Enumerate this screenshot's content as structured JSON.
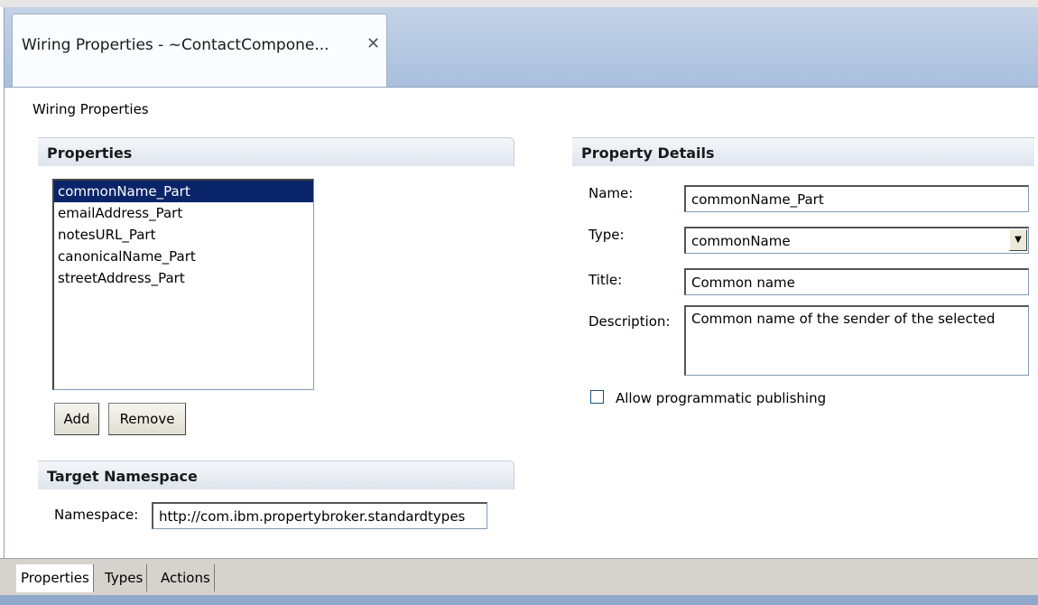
{
  "editor_tab": {
    "title": "Wiring Properties - ~ContactCompone...",
    "close_icon": "close-icon"
  },
  "form": {
    "title": "Wiring Properties"
  },
  "properties_section": {
    "title": "Properties",
    "items": [
      "commonName_Part",
      "emailAddress_Part",
      "notesURL_Part",
      "canonicalName_Part",
      "streetAddress_Part"
    ],
    "selected_index": 0,
    "add_label": "Add",
    "remove_label": "Remove"
  },
  "namespace_section": {
    "title": "Target Namespace",
    "namespace_label": "Namespace:",
    "namespace_value": "http://com.ibm.propertybroker.standardtypes"
  },
  "details_section": {
    "title": "Property Details",
    "name_label": "Name:",
    "name_value": "commonName_Part",
    "type_label": "Type:",
    "type_value": "commonName",
    "title_label": "Title:",
    "title_value": "Common name",
    "description_label": "Description:",
    "description_value": "Common name of the sender of the selected",
    "publishing_label": "Allow programmatic publishing",
    "publishing_checked": false
  },
  "bottom_tabs": [
    {
      "label": "Properties",
      "active": true
    },
    {
      "label": "Types",
      "active": false
    },
    {
      "label": "Actions",
      "active": false
    }
  ],
  "colors": {
    "selection": "#0a246a",
    "tab_band": "#a9bfdc"
  }
}
